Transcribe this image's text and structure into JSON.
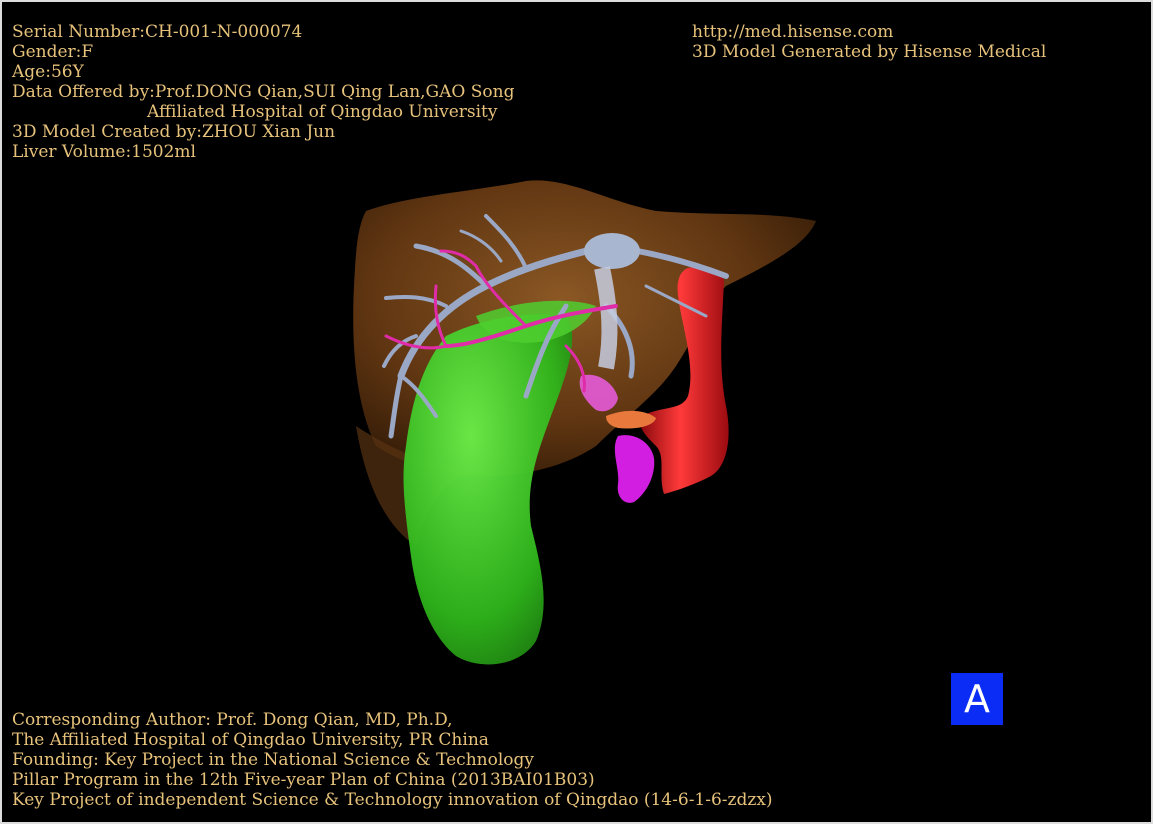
{
  "top_left": {
    "serial": "Serial Number:CH-001-N-000074",
    "gender": "Gender:F",
    "age": "Age:56Y",
    "offered_by": "Data Offered by:Prof.DONG Qian,SUI Qing Lan,GAO Song",
    "hospital": "Affiliated Hospital of Qingdao University",
    "created_by": "3D Model Created by:ZHOU Xian Jun",
    "liver_volume": "Liver Volume:1502ml"
  },
  "top_right": {
    "url": "http://med.hisense.com",
    "generated_by": "3D Model Generated by Hisense Medical"
  },
  "bottom_left": {
    "line1": "Corresponding Author: Prof. Dong Qian, MD, Ph.D,",
    "line2": "The Affiliated Hospital of Qingdao University, PR China",
    "line3": "Founding: Key Project in the National Science & Technology",
    "line4": "Pillar Program in the 12th Five-year Plan of China (2013BAI01B03)",
    "line5": "Key Project of independent Science & Technology innovation of Qingdao (14-6-1-6-zdzx)"
  },
  "view_badge": "A",
  "colors": {
    "text": "#e7c27b",
    "background": "#000000",
    "liver": "#8a4f1c",
    "gallbladder": "#3fd42a",
    "hepatic_veins": "#9aa8c6",
    "portal_vein": "#e02ca8",
    "vena_cava": "#e3141a",
    "badge": "#0a2cf5"
  }
}
